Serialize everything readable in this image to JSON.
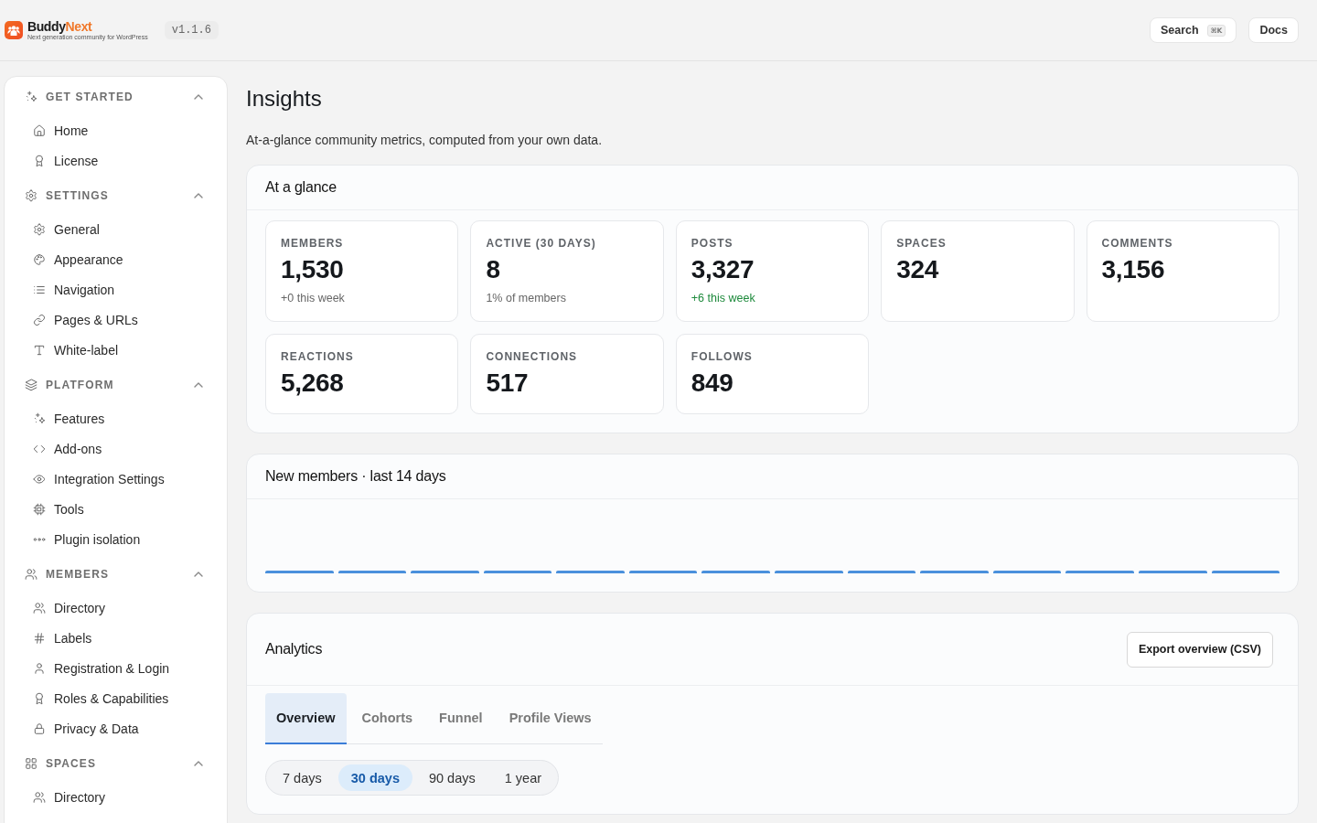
{
  "header": {
    "brand": {
      "name": "Buddy",
      "name_accent": "Next",
      "tagline": "Next generation community for WordPress"
    },
    "version": "v1.1.6",
    "buttons": [
      {
        "kind": "search",
        "label": "Search",
        "shortcut": "⌘K"
      },
      {
        "kind": "link",
        "label": "Docs"
      }
    ]
  },
  "sidebar": {
    "sections": [
      {
        "title": "GET STARTED",
        "expanded": true,
        "items": [
          "Home",
          "License"
        ]
      },
      {
        "title": "SETTINGS",
        "expanded": true,
        "items": [
          "General",
          "Appearance",
          "Navigation",
          "Pages & URLs",
          "White-label"
        ]
      },
      {
        "title": "PLATFORM",
        "expanded": true,
        "items": [
          "Features",
          "Add-ons",
          "Integration Settings",
          "Tools",
          "Plugin isolation"
        ]
      },
      {
        "title": "MEMBERS",
        "expanded": true,
        "items": [
          "Directory",
          "Labels",
          "Registration & Login",
          "Roles & Capabilities",
          "Privacy & Data"
        ]
      },
      {
        "title": "SPACES",
        "expanded": true,
        "items": [
          "Directory"
        ]
      }
    ]
  },
  "page": {
    "title": "Insights",
    "subtitle": "At-a-glance community metrics, computed from your own data."
  },
  "at_a_glance": {
    "title": "At a glance",
    "stats": [
      {
        "label": "MEMBERS",
        "value": "1,530",
        "note": "+0 this week",
        "positive": false
      },
      {
        "label": "ACTIVE (30 DAYS)",
        "value": "8",
        "note": "1% of members",
        "positive": false
      },
      {
        "label": "POSTS",
        "value": "3,327",
        "note": "+6 this week",
        "positive": true
      },
      {
        "label": "SPACES",
        "value": "324"
      },
      {
        "label": "COMMENTS",
        "value": "3,156"
      },
      {
        "label": "REACTIONS",
        "value": "5,268"
      },
      {
        "label": "CONNECTIONS",
        "value": "517"
      },
      {
        "label": "FOLLOWS",
        "value": "849"
      }
    ]
  },
  "new_members": {
    "title": "New members · last 14 days"
  },
  "analytics": {
    "title": "Analytics",
    "export_button": "Export overview (CSV)",
    "tabs": [
      {
        "label": "Overview",
        "selected": true
      },
      {
        "label": "Cohorts",
        "selected": false
      },
      {
        "label": "Funnel",
        "selected": false
      },
      {
        "label": "Profile Views",
        "selected": false
      }
    ],
    "periods": [
      {
        "label": "7 days",
        "selected": false
      },
      {
        "label": "30 days",
        "selected": true
      },
      {
        "label": "90 days",
        "selected": false
      },
      {
        "label": "1 year",
        "selected": false
      }
    ]
  }
}
